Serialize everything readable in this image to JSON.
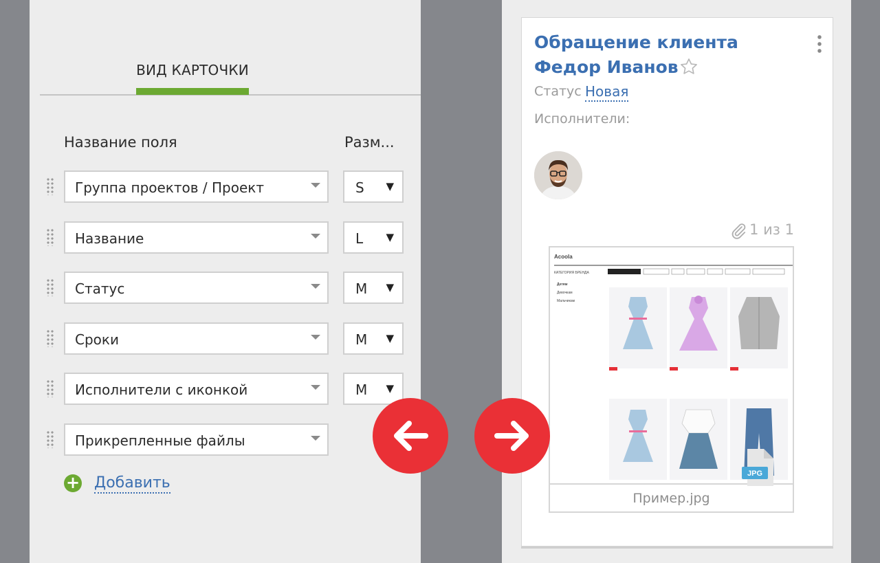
{
  "settings": {
    "tab_title": "ВИД КАРТОЧКИ",
    "columns": {
      "name": "Название поля",
      "size": "Разм..."
    },
    "fields": [
      {
        "label": "Группа проектов / Проект",
        "size": "S"
      },
      {
        "label": "Название",
        "size": "L"
      },
      {
        "label": "Статус",
        "size": "M"
      },
      {
        "label": "Сроки",
        "size": "M"
      },
      {
        "label": "Исполнители с иконкой",
        "size": "M"
      },
      {
        "label": "Прикрепленные файлы",
        "size": ""
      }
    ],
    "add_label": "Добавить"
  },
  "card": {
    "title_line1": "Обращение клиента",
    "title_line2": "Федор Иванов",
    "status_label": "Статус",
    "status_value": "Новая",
    "assignees_label": "Исполнители:",
    "attachments_count": "1 из 1",
    "attachment_name": "Пример.jpg",
    "file_type": "JPG"
  },
  "preview_site": {
    "brand": "Acoola",
    "category_label": "КАТЕГОРИЯ БРЕНДА",
    "sidebar": [
      "Детям",
      "Девочкам",
      "Мальчикам"
    ]
  },
  "colors": {
    "accent_green": "#6ca932",
    "link_blue": "#3b6fb1",
    "arrow_red": "#ea3036"
  },
  "icons": [
    "drag-handle-icon",
    "chevron-down-icon",
    "plus-circle-icon",
    "arrow-left-icon",
    "arrow-right-icon",
    "star-icon",
    "kebab-menu-icon",
    "paperclip-icon",
    "jpg-file-icon"
  ]
}
